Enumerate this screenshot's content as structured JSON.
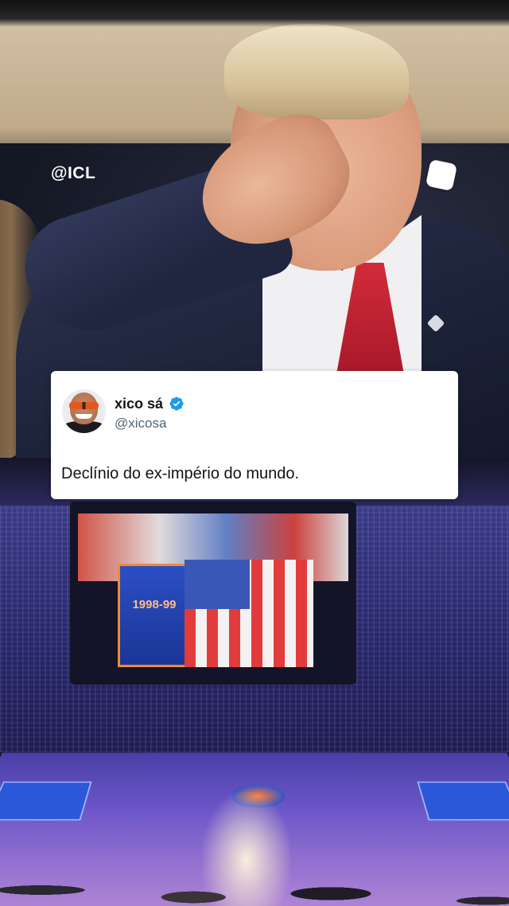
{
  "watermark": {
    "handle": "@ICL"
  },
  "top_right_icon": "rounded-square-icon",
  "tweet": {
    "display_name": "xico sá",
    "username": "@xicosa",
    "verified": true,
    "verified_icon": "verified-badge-icon",
    "verified_color": "#1d9bf0",
    "text": "Declínio do ex-império do mundo."
  },
  "arena": {
    "banner_text": "1998-99"
  }
}
